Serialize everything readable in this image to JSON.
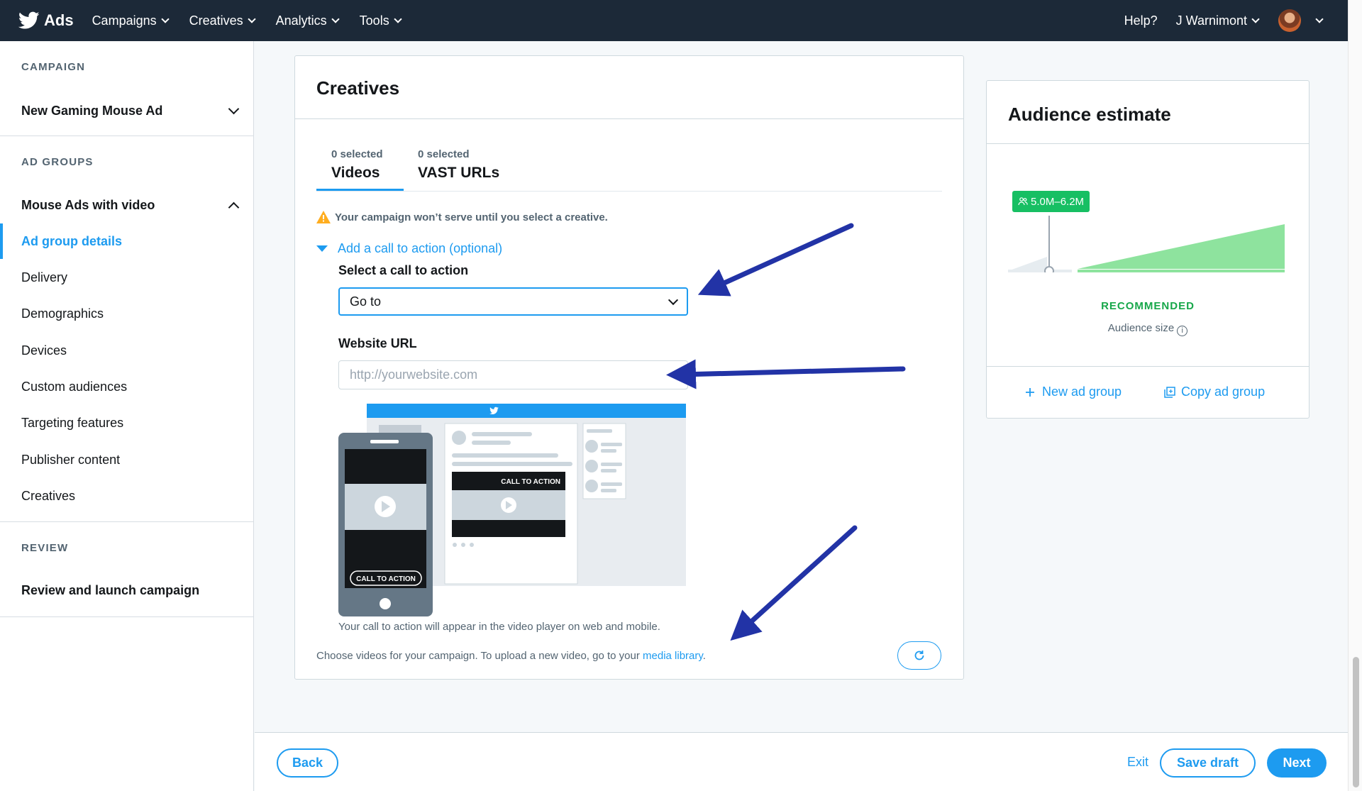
{
  "topbar": {
    "brand": "Ads",
    "nav": [
      "Campaigns",
      "Creatives",
      "Analytics",
      "Tools"
    ],
    "help": "Help?",
    "user": "J Warnimont"
  },
  "sidebar": {
    "campaign_label": "CAMPAIGN",
    "campaign_name": "New Gaming Mouse Ad",
    "ad_groups_label": "AD GROUPS",
    "ad_group_name": "Mouse Ads with video",
    "items": [
      {
        "label": "Ad group details"
      },
      {
        "label": "Delivery"
      },
      {
        "label": "Demographics"
      },
      {
        "label": "Devices"
      },
      {
        "label": "Custom audiences"
      },
      {
        "label": "Targeting features"
      },
      {
        "label": "Publisher content"
      },
      {
        "label": "Creatives"
      }
    ],
    "review_label": "REVIEW",
    "review_item": "Review and launch campaign"
  },
  "creatives": {
    "title": "Creatives",
    "tabs": [
      {
        "count": "0 selected",
        "name": "Videos"
      },
      {
        "count": "0 selected",
        "name": "VAST URLs"
      }
    ],
    "warning": "Your campaign won’t serve until you select a creative.",
    "cta_toggle": "Add a call to action (optional)",
    "select_label": "Select a call to action",
    "select_value": "Go to",
    "url_label": "Website URL",
    "url_placeholder": "http://yourwebsite.com",
    "illustration_cta": "CALL TO ACTION",
    "cta_note": "Your call to action will appear in the video player on web and mobile.",
    "choose_text": "Choose videos for your campaign. To upload a new video, go to your ",
    "media_library_link": "media library",
    "choose_suffix": "."
  },
  "audience": {
    "title": "Audience estimate",
    "range": "5.0M–6.2M",
    "recommended": "RECOMMENDED",
    "size_label": "Audience size",
    "new_ad_group": "New ad group",
    "copy_ad_group": "Copy ad group"
  },
  "footer": {
    "back": "Back",
    "exit": "Exit",
    "save_draft": "Save draft",
    "next": "Next"
  },
  "colors": {
    "accent": "#1d9bf0",
    "topbar": "#1c2938",
    "recommended": "#17bf63",
    "annotation_arrow": "#2233a6"
  },
  "icons": [
    "twitter-bird-icon",
    "warning-icon",
    "caret-down-icon",
    "refresh-icon",
    "plus-icon",
    "copy-icon",
    "info-icon",
    "people-icon"
  ]
}
